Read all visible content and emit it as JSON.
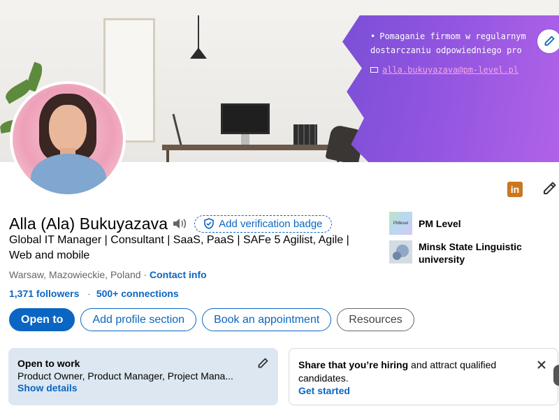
{
  "banner": {
    "bullet_text": "Pomaganie firmom w regularnym dostarczaniu odpowiedniego pro",
    "email": "alla.bukuyazava@pm-level.pl"
  },
  "profile": {
    "name": "Alla (Ala) Bukuyazava",
    "verify_label": "Add verification badge",
    "headline": "Global IT Manager | Consultant | SaaS, PaaS | SAFe 5 Agilist, Agile | Web and mobile",
    "location": "Warsaw, Mazowieckie, Poland",
    "separator": "·",
    "contact_label": "Contact info",
    "followers": "1,371 followers",
    "connections": "500+ connections"
  },
  "actions": {
    "open_to": "Open to",
    "add_section": "Add profile section",
    "book": "Book an appointment",
    "resources": "Resources"
  },
  "orgs": [
    {
      "name": "PM Level",
      "logo_text": "PMlevel"
    },
    {
      "name": "Minsk State Linguistic university"
    }
  ],
  "linkedin_badge": "in",
  "open_to_work": {
    "title": "Open to work",
    "description": "Product Owner, Product Manager, Project Mana...",
    "link": "Show details"
  },
  "hiring": {
    "bold_text": "Share that you’re hiring",
    "rest_text": " and attract qualified candidates.",
    "link": "Get started"
  },
  "colors": {
    "brand": "#0a66c2",
    "banner_purple": "#9255e0",
    "open_to_work_bg": "#dde7f1"
  },
  "icons": [
    "pencil-icon",
    "speaker-icon",
    "shield-check-icon",
    "linkedin-icon",
    "close-icon",
    "mail-icon"
  ]
}
